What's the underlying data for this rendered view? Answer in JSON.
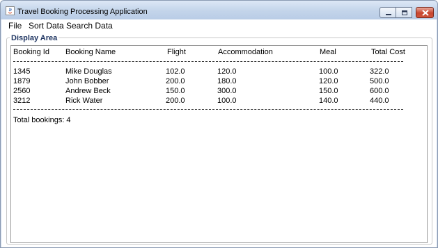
{
  "window": {
    "title": "Travel Booking Processing Application",
    "controls": {
      "minimize": "minimize-icon",
      "maximize": "maximize-icon",
      "close": "close-icon"
    }
  },
  "menu": {
    "items": [
      "File",
      "Sort Data",
      "Search Data"
    ]
  },
  "display": {
    "title": "Display Area",
    "headers": [
      "Booking Id",
      "Booking Name",
      "Flight",
      "Accommodation",
      "Meal",
      "Total Cost"
    ],
    "rows": [
      [
        "1345",
        "Mike Douglas",
        "102.0",
        "120.0",
        "100.0",
        "322.0"
      ],
      [
        "1879",
        "John Bobber",
        "200.0",
        "180.0",
        "120.0",
        "500.0"
      ],
      [
        "2560",
        "Andrew Beck",
        "150.0",
        "300.0",
        "150.0",
        "600.0"
      ],
      [
        "3212",
        "Rick Water",
        "200.0",
        "100.0",
        "140.0",
        "440.0"
      ]
    ],
    "total": "Total bookings: 4"
  },
  "colors": {
    "titlebar": "#c3d4ea",
    "close_button": "#c8452e",
    "group_title": "#1f3562"
  }
}
